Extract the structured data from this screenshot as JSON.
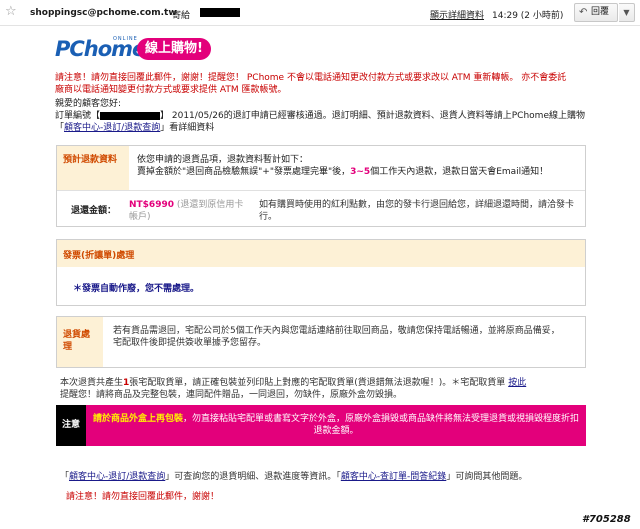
{
  "header": {
    "sender": "shoppingsc@pchome.com.tw",
    "sent_to_label": "寄給",
    "show_details": "顯示詳細資料",
    "time": "14:29 (2 小時前)",
    "reply": "回覆",
    "more": "▼"
  },
  "logo": {
    "brand": "PChome",
    "online": "ONLINE",
    "shop": "線上購物!"
  },
  "warning_top": "請注意！請勿直接回覆此郵件，謝謝！提醒您！ PChome 不會以電話通知更改付款方式或要求改以 ATM 重新轉帳。 亦不會委託廠商以電話通知變更付款方式或要求提供 ATM 匯款帳號。",
  "greeting": {
    "line1": "親愛的顧客您好:",
    "order_prefix": "訂單編號【",
    "order_suffix": "】 2011/05/26的退訂申請已經審核通過。退訂明細、預計退款資料、退貨人資料等請上PChome線上購物「",
    "link": "顧客中心-退訂/退款查詢",
    "end": "」看詳細資料"
  },
  "refund": {
    "title": "預計退款資料",
    "line1": "依您申請的退貨品項，退款資料暫計如下：",
    "line2_a": "賣掉金額於\"退回商品檢驗無誤\"+\"發票處理完畢\"後，",
    "line2_b": "3~5",
    "line2_c": "個工作天內退款，退款日當天會Email通知！",
    "amount_label": "退還金額：",
    "amount": "NT$6990",
    "amount_method": "(退還到原信用卡帳戶)",
    "amount_note": "如有購買時使用的紅利點數，由您的發卡行退回給您，詳細退還時間，請洽發卡行。"
  },
  "invoice": {
    "title": "發票(折讓單)處理",
    "note": "＊發票自動作廢，您不需處理。"
  },
  "return": {
    "title": "退貨處理",
    "body1": "若有貨品需退回，宅配公司於5個工作天內與您電話連絡前往取回商品，敬請您保持電話暢通，並將原商品備妥，",
    "body2": "宅配取件後即提供簽收單據予您留存。",
    "extra_a": "本次退貨共產生",
    "extra_one": "1",
    "extra_b": "張宅配取貨單，請正確包裝並列印貼上對應的宅配取貨單(貨退錯無法退款喔！)。＊宅配取貨單",
    "extra_link": "按此",
    "extra_c": "提醒您！請將商品及完整包裝，連同配件贈品，一同退回，勿缺件，原廠外盒勿毀損。"
  },
  "notice": {
    "label": "注意",
    "highlight": "請於商品外盒上再包裝",
    "text": "，勿直接粘貼宅配單或書寫文字於外盒，原廠外盒損毀或商品缺件將無法受理退貨或視損毀程度折扣退款金額。"
  },
  "footer": {
    "link1": "顧客中心-退訂/退款查詢",
    "text1": "」可查詢您的退貨明細、退款進度等資訊。「",
    "link2": "顧客中心-查訂單-問答紀錄",
    "text2": "」可詢問其他問題。",
    "warn": "請注意！請勿直接回覆此郵件，謝謝！"
  },
  "watermark": "#705288"
}
